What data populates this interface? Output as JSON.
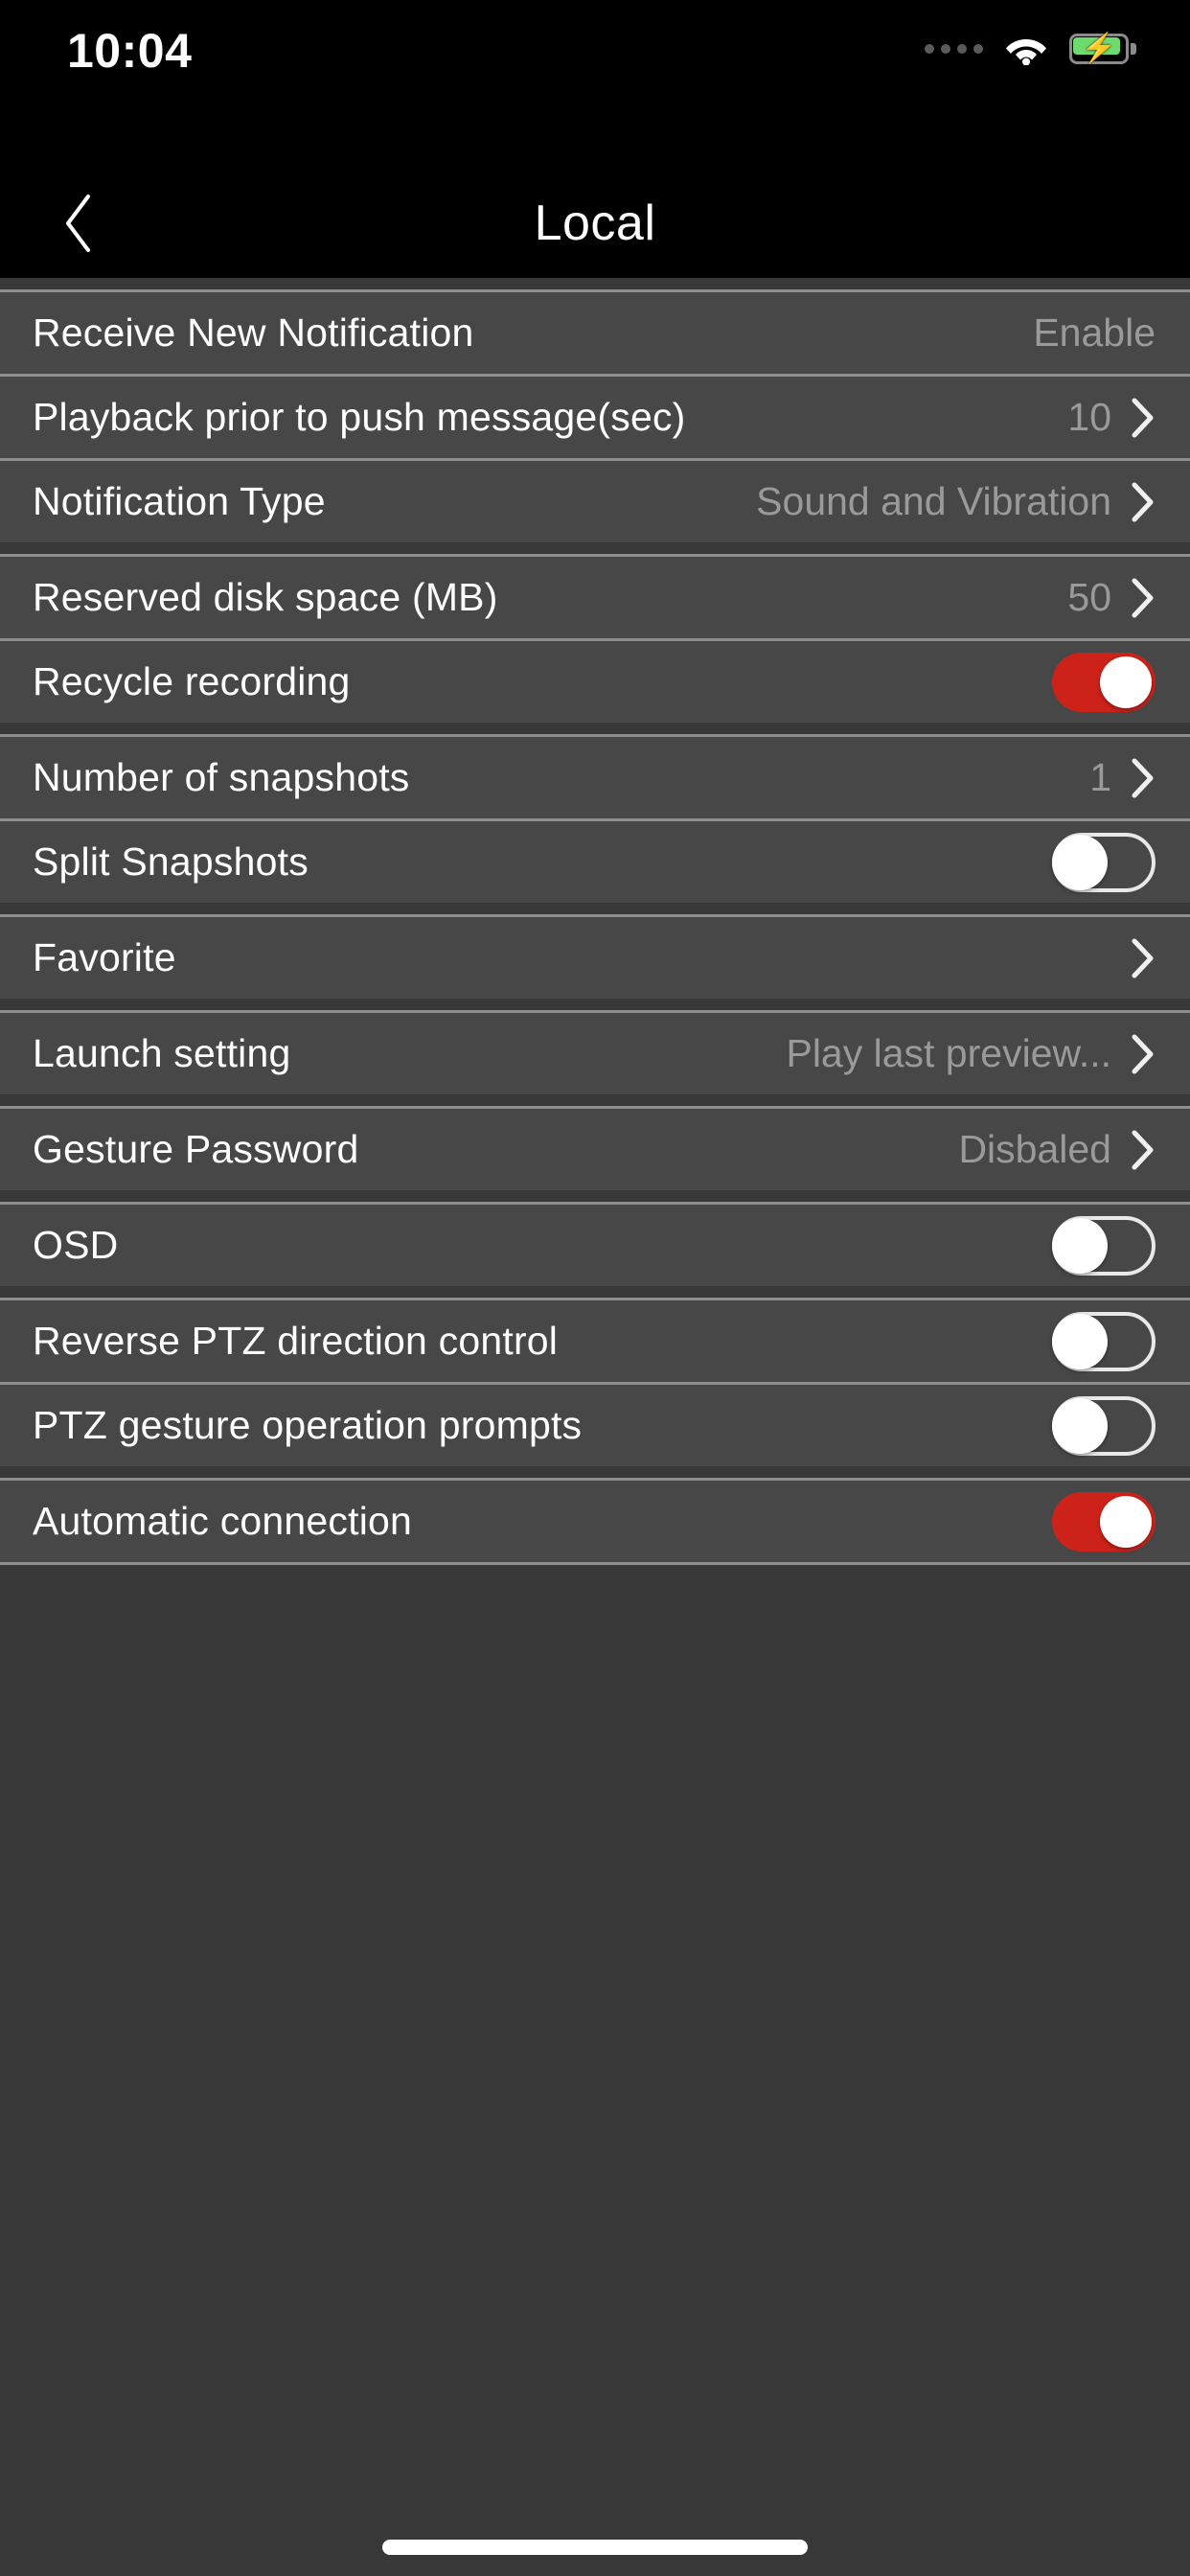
{
  "status_bar": {
    "time": "10:04",
    "signal_icon": "signal-dots-icon",
    "wifi_icon": "wifi-icon",
    "battery_icon": "battery-charging-icon",
    "battery_charging": true,
    "battery_color": "#6ddb6d"
  },
  "nav": {
    "title": "Local",
    "back_icon": "chevron-left-icon"
  },
  "theme": {
    "row_bg": "#474747",
    "page_bg": "#383838",
    "nav_bg": "#000000",
    "label_color": "#ffffff",
    "value_color": "#9a9a9a",
    "separator_color": "#8e8e8e",
    "toggle_on_color": "#cc2219",
    "toggle_off_border": "#e8e8e8"
  },
  "groups": [
    {
      "rows": [
        {
          "name": "receive-new-notification",
          "label": "Receive New Notification",
          "type": "value",
          "value": "Enable",
          "chevron": false
        },
        {
          "name": "playback-prior-to-push-message",
          "label": "Playback prior to push message(sec)",
          "type": "value",
          "value": "10",
          "chevron": true
        },
        {
          "name": "notification-type",
          "label": "Notification Type",
          "type": "value",
          "value": "Sound and Vibration",
          "chevron": true
        }
      ]
    },
    {
      "rows": [
        {
          "name": "reserved-disk-space",
          "label": "Reserved disk space (MB)",
          "type": "value",
          "value": "50",
          "chevron": true
        },
        {
          "name": "recycle-recording",
          "label": "Recycle recording",
          "type": "toggle",
          "toggle_state": "on"
        }
      ]
    },
    {
      "rows": [
        {
          "name": "number-of-snapshots",
          "label": "Number of snapshots",
          "type": "value",
          "value": "1",
          "chevron": true
        },
        {
          "name": "split-snapshots",
          "label": "Split Snapshots",
          "type": "toggle",
          "toggle_state": "off"
        }
      ]
    },
    {
      "rows": [
        {
          "name": "favorite",
          "label": "Favorite",
          "type": "value",
          "value": "",
          "chevron": true
        }
      ]
    },
    {
      "rows": [
        {
          "name": "launch-setting",
          "label": "Launch setting",
          "type": "value",
          "value": "Play last preview...",
          "chevron": true
        }
      ]
    },
    {
      "rows": [
        {
          "name": "gesture-password",
          "label": "Gesture Password",
          "type": "value",
          "value": "Disbaled",
          "chevron": true
        }
      ]
    },
    {
      "rows": [
        {
          "name": "osd",
          "label": "OSD",
          "type": "toggle",
          "toggle_state": "off"
        }
      ]
    },
    {
      "rows": [
        {
          "name": "reverse-ptz-direction-control",
          "label": "Reverse PTZ direction control",
          "type": "toggle",
          "toggle_state": "off"
        },
        {
          "name": "ptz-gesture-operation-prompts",
          "label": "PTZ gesture operation prompts",
          "type": "toggle",
          "toggle_state": "off"
        }
      ]
    },
    {
      "rows": [
        {
          "name": "automatic-connection",
          "label": "Automatic connection",
          "type": "toggle",
          "toggle_state": "on"
        }
      ]
    }
  ],
  "home_indicator": "home-indicator"
}
